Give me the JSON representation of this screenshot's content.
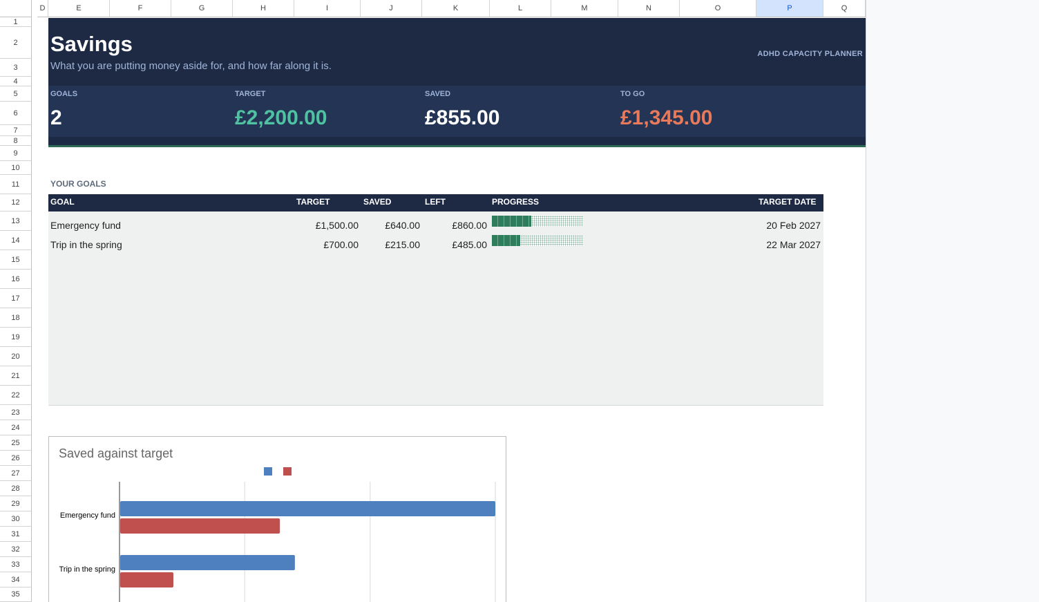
{
  "columns": [
    "D",
    "E",
    "F",
    "G",
    "H",
    "I",
    "J",
    "K",
    "L",
    "M",
    "N",
    "O",
    "P",
    "Q"
  ],
  "selected_column": "P",
  "rows": [
    "1",
    "2",
    "3",
    "4",
    "5",
    "6",
    "7",
    "8",
    "9",
    "10",
    "11",
    "12",
    "13",
    "14",
    "15",
    "16",
    "17",
    "18",
    "19",
    "20",
    "21",
    "22",
    "23",
    "24",
    "25",
    "26",
    "27",
    "28",
    "29",
    "30",
    "31",
    "32",
    "33",
    "34",
    "35"
  ],
  "header": {
    "title": "Savings",
    "subtitle": "What you are putting money aside for, and how far along it is.",
    "brand": "ADHD CAPACITY PLANNER"
  },
  "kpis": [
    {
      "label": "GOALS",
      "value": "2",
      "color": "#ffffff"
    },
    {
      "label": "TARGET",
      "value": "£2,200.00",
      "color": "#4fc3a1"
    },
    {
      "label": "SAVED",
      "value": "£855.00",
      "color": "#ffffff"
    },
    {
      "label": "TO GO",
      "value": "£1,345.00",
      "color": "#e8795a"
    }
  ],
  "goals_section": {
    "label": "YOUR GOALS",
    "columns": {
      "goal": "GOAL",
      "target": "TARGET",
      "saved": "SAVED",
      "left": "LEFT",
      "progress": "PROGRESS",
      "date": "TARGET DATE"
    },
    "rows": [
      {
        "goal": "Emergency fund",
        "target": "£1,500.00",
        "saved": "£640.00",
        "left": "£860.00",
        "progress": 0.43,
        "date": "20 Feb 2027"
      },
      {
        "goal": "Trip in the spring",
        "target": "£700.00",
        "saved": "£215.00",
        "left": "£485.00",
        "progress": 0.31,
        "date": "22 Mar 2027"
      }
    ]
  },
  "chart_data": {
    "type": "bar",
    "orientation": "horizontal",
    "title": "Saved against target",
    "categories": [
      "Emergency fund",
      "Trip in the spring"
    ],
    "series": [
      {
        "values": [
          1500,
          700
        ],
        "color": "#4e7fbe"
      },
      {
        "values": [
          640,
          215
        ],
        "color": "#c0504d"
      }
    ],
    "xlim": [
      0,
      1500
    ],
    "grid": true,
    "legend": "top"
  }
}
